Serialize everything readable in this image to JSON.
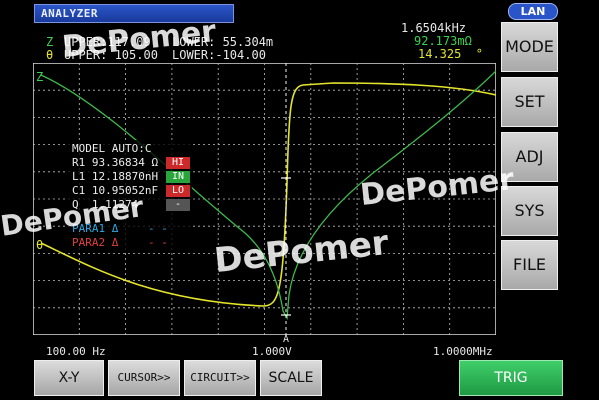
{
  "window": {
    "title": "ANALYZER",
    "lan": "LAN"
  },
  "header": {
    "z_label": "Z",
    "theta_label": "θ",
    "z_upper": "UPPER:117.09",
    "z_lower": "LOWER: 55.304m",
    "theta_upper": "UPPER: 105.00",
    "theta_lower": "LOWER:-104.00",
    "freq": "1.6504kHz",
    "z_value": "92.173mΩ",
    "theta_value": "14.325  °"
  },
  "plot": {
    "left_axis_top": "Z",
    "left_axis_mid": "θ",
    "cursor_label": "A",
    "x_start": "100.00 Hz",
    "x_mid": "1.000V",
    "x_end": "1.0000MHz"
  },
  "model_panel": {
    "title": "MODEL AUTO:C",
    "rows": [
      {
        "text": "R1 93.36834 Ω",
        "judge": "HI",
        "color": "#cc2a2a"
      },
      {
        "text": "L1 12.18870nH",
        "judge": "IN",
        "color": "#29a53b"
      },
      {
        "text": "C1 10.95052nF",
        "judge": "LO",
        "color": "#cc2a2a"
      },
      {
        "text": "Q  1.11274",
        "judge": "-",
        "color": "#555555"
      }
    ],
    "para1": "PARA1 Δ",
    "para1_value": "- -",
    "para2": "PARA2 Δ",
    "para2_value": "- -"
  },
  "side_menu": {
    "mode": "MODE",
    "set": "SET",
    "adj": "ADJ",
    "sys": "SYS",
    "file": "FILE"
  },
  "bottom_menu": {
    "xy": "X-Y",
    "cursor": "CURSOR>>",
    "circuit": "CIRCUIT>>",
    "scale": "SCALE",
    "trig": "TRIG"
  },
  "watermark": "DePomer"
}
